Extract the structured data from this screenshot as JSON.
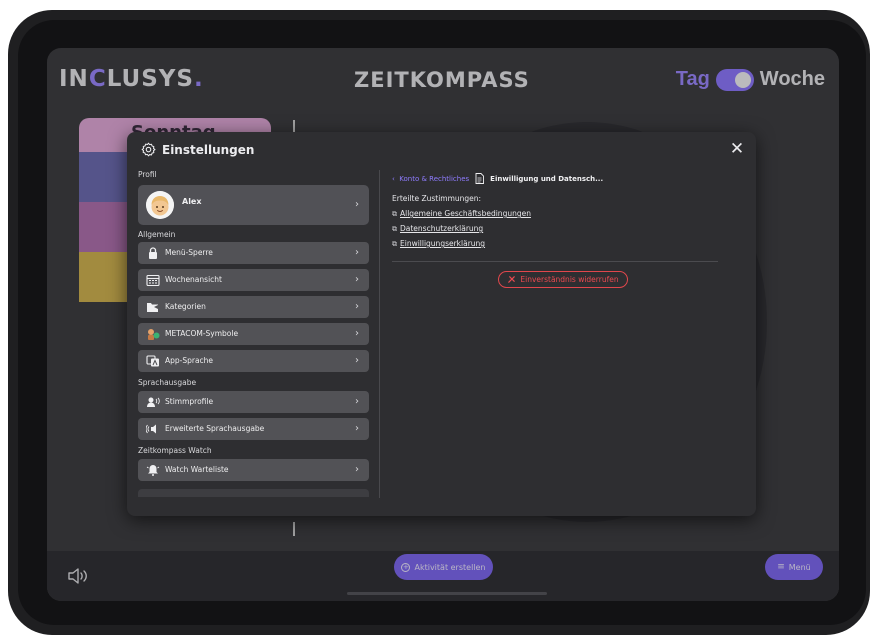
{
  "app": {
    "brand_before": "IN",
    "brand_highlight": "C",
    "brand_after": "LUSYS",
    "brand_dot": ".",
    "title": "ZEITKOMPASS",
    "view_left": "Tag",
    "view_right": "Woche",
    "accent": "#7d66f2"
  },
  "background": {
    "day_label": "Sonntag"
  },
  "modal": {
    "title": "Einstellungen",
    "close_symbol": "✕",
    "profile_section": "Profil",
    "profile_name": "Alex",
    "general_section": "Allgemein",
    "general_items": [
      {
        "label": "Menü-Sperre",
        "icon": "lock-icon"
      },
      {
        "label": "Wochenansicht",
        "icon": "calendar-icon"
      },
      {
        "label": "Kategorien",
        "icon": "folder-tag-icon"
      },
      {
        "label": "METACOM-Symbole",
        "icon": "metacom-symbols-icon"
      },
      {
        "label": "App-Sprache",
        "icon": "translate-icon"
      }
    ],
    "speech_section": "Sprachausgabe",
    "speech_items": [
      {
        "label": "Stimmprofile",
        "icon": "voice-profile-icon"
      },
      {
        "label": "Erweiterte Sprachausgabe",
        "icon": "speaker-waves-icon"
      }
    ],
    "watch_section": "Zeitkompass Watch",
    "watch_items": [
      {
        "label": "Watch Warteliste",
        "icon": "bell-icon"
      }
    ],
    "breadcrumb_back": "Konto & Rechtliches",
    "breadcrumb_current": "Einwilligung und Datensch...",
    "consents_label": "Erteilte Zustimmungen:",
    "consent_links": [
      "Allgemeine Geschäftsbedingungen",
      "Datenschutzerklärung",
      "Einwilligungserklärung"
    ],
    "revoke_label": "Einverständnis widerrufen",
    "revoke_color": "#e0474c"
  },
  "bottom_bar": {
    "create_label": "Aktivität erstellen",
    "menu_label": "Menü"
  }
}
